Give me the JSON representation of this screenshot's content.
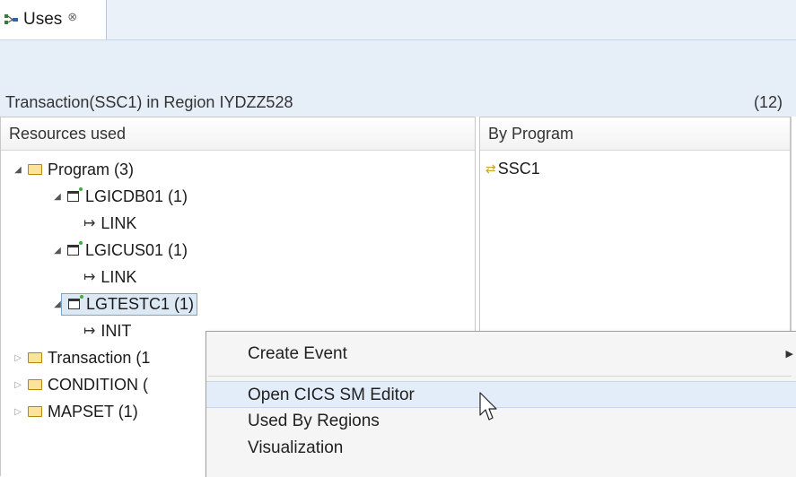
{
  "tab": {
    "label": "Uses",
    "close_glyph": "⊗",
    "icon": "uses-view-icon"
  },
  "header": {
    "title": "Transaction(SSC1) in Region IYDZZ528",
    "count": "(12)"
  },
  "left_panel": {
    "column_header": "Resources used",
    "tree": [
      {
        "label": "Program  (3)",
        "icon": "folder-icon",
        "expanded": true
      },
      {
        "label": "LGICDB01 (1)",
        "icon": "program-icon",
        "expanded": true
      },
      {
        "label": "LINK",
        "icon": "link-arrow-icon"
      },
      {
        "label": "LGICUS01 (1)",
        "icon": "program-icon",
        "expanded": true
      },
      {
        "label": "LINK",
        "icon": "link-arrow-icon"
      },
      {
        "label": "LGTESTC1 (1)",
        "icon": "program-icon",
        "expanded": true,
        "selected": true
      },
      {
        "label": "INIT",
        "icon": "link-arrow-icon"
      },
      {
        "label": "Transaction  (1",
        "icon": "folder-icon",
        "expanded": false
      },
      {
        "label": "CONDITION  (",
        "icon": "folder-icon",
        "expanded": false
      },
      {
        "label": "MAPSET  (1)",
        "icon": "folder-icon",
        "expanded": false
      }
    ]
  },
  "right_panel": {
    "column_header": "By Program",
    "items": [
      {
        "label": "SSC1",
        "icon": "transaction-icon"
      }
    ]
  },
  "context_menu": {
    "items": [
      {
        "label": "Create Event",
        "has_submenu": true
      },
      {
        "label": "Open CICS SM Editor",
        "highlighted": true
      },
      {
        "label": "Used By Regions"
      },
      {
        "label": "Visualization"
      }
    ]
  },
  "colors": {
    "tab_band": "#ebf1f8",
    "header_band": "#e6eef8",
    "selection": "#dde8f5",
    "menu_bg": "#f5f5f5",
    "menu_highlight": "#e3edf9"
  }
}
